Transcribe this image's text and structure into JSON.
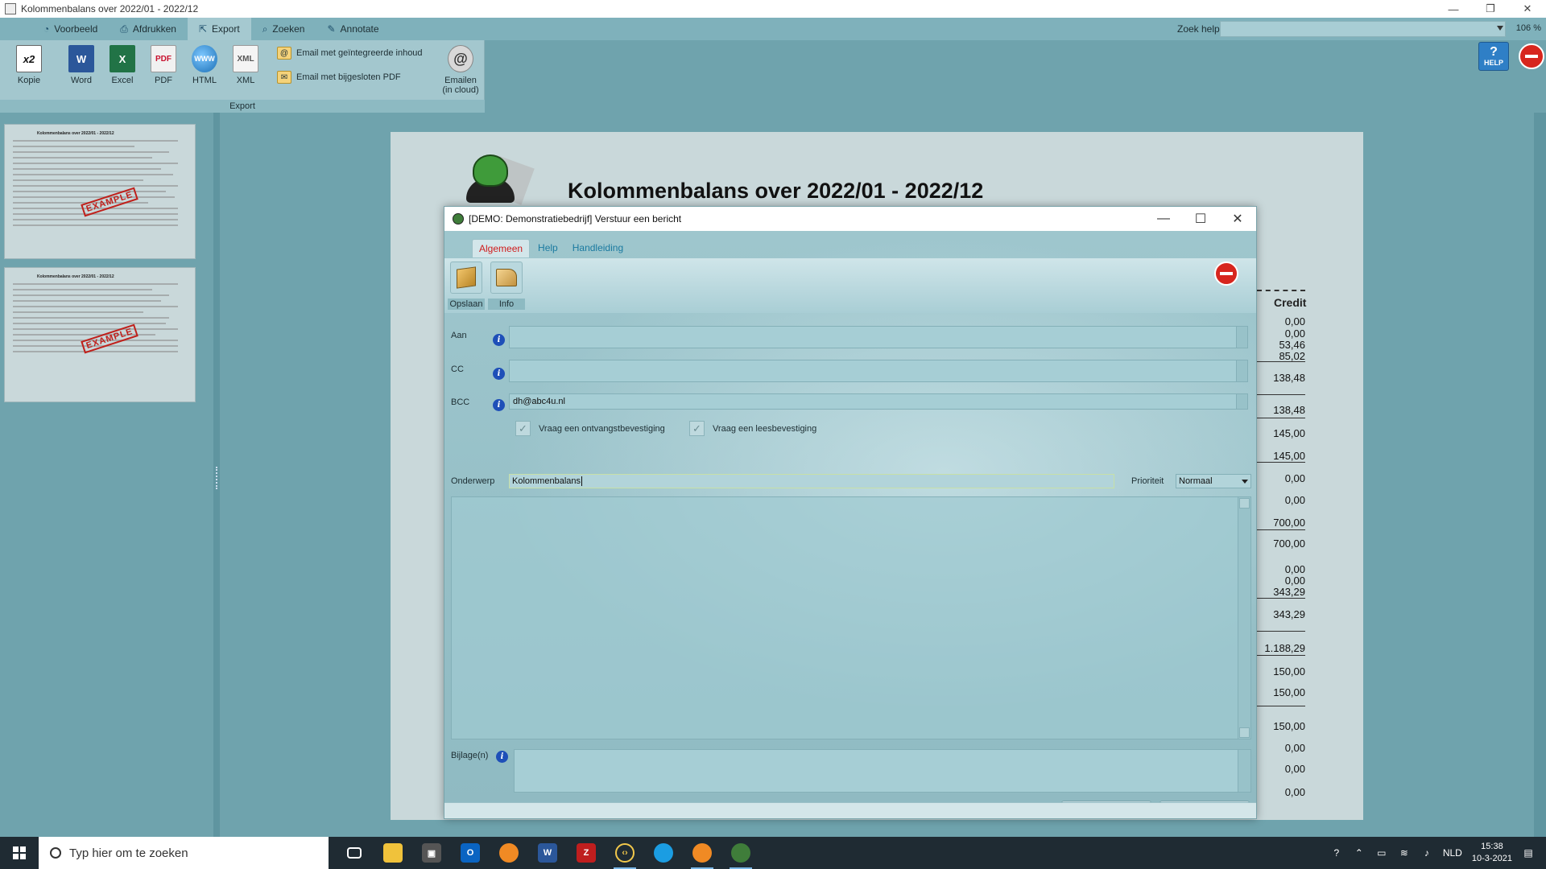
{
  "window": {
    "title": "Kolommenbalans over 2022/01 - 2022/12"
  },
  "menu": {
    "items": [
      {
        "label": "Voorbeeld",
        "icon": "preview-icon"
      },
      {
        "label": "Afdrukken",
        "icon": "printer-icon"
      },
      {
        "label": "Export",
        "icon": "export-icon"
      },
      {
        "label": "Zoeken",
        "icon": "search-icon"
      },
      {
        "label": "Annotate",
        "icon": "pencil-icon"
      }
    ],
    "help_label": "Zoek help",
    "zoom": "106 %"
  },
  "ribbon": {
    "buttons": [
      {
        "label": "Kopie",
        "glyph": "x2"
      },
      {
        "label": "Word",
        "glyph": "W"
      },
      {
        "label": "Excel",
        "glyph": "X"
      },
      {
        "label": "PDF",
        "glyph": "PDF"
      },
      {
        "label": "HTML",
        "glyph": "WWW"
      },
      {
        "label": "XML",
        "glyph": "XML"
      }
    ],
    "email_integrated": "Email met geïntegreerde inhoud",
    "email_pdf": "Email met bijgesloten PDF",
    "email_cloud_line1": "Emailen",
    "email_cloud_line2": "(in cloud)",
    "group_label": "Export",
    "help_button": "HELP"
  },
  "thumbnails": {
    "title": "Kolommenbalans over 2022/01 - 2022/12",
    "stamp": "EXAMPLE"
  },
  "document": {
    "title": "Kolommenbalans over 2022/01 - 2022/12",
    "credit_header": "Credit",
    "credit_values": [
      "0,00",
      "0,00",
      "53,46",
      "85,02",
      "138,48",
      "138,48",
      "145,00",
      "145,00",
      "0,00",
      "0,00",
      "700,00",
      "700,00",
      "0,00",
      "0,00",
      "343,29",
      "343,29",
      "1.188,29",
      "150,00",
      "150,00",
      "150,00",
      "0,00",
      "0,00",
      "0,00"
    ]
  },
  "dialog": {
    "title": "[DEMO: Demonstratiebedrijf]  Verstuur een bericht",
    "tabs": [
      "Algemeen",
      "Help",
      "Handleiding"
    ],
    "active_tab": "Algemeen",
    "toolbar": {
      "save_label": "Opslaan",
      "info_label": "Info"
    },
    "fields": {
      "to_label": "Aan",
      "to_value": "",
      "cc_label": "CC",
      "cc_value": "",
      "bcc_label": "BCC",
      "bcc_value": "dh@abc4u.nl",
      "receipt_label": "Vraag een ontvangstbevestiging",
      "read_label": "Vraag een leesbevestiging",
      "subject_label": "Onderwerp",
      "subject_value": "Kolommenbalans",
      "priority_label": "Prioriteit",
      "priority_value": "Normaal",
      "attachments_label": "Bijlage(n)"
    }
  },
  "taskbar": {
    "search_placeholder": "Typ hier om te zoeken",
    "language": "NLD",
    "time": "15:38",
    "date": "10-3-2021"
  }
}
